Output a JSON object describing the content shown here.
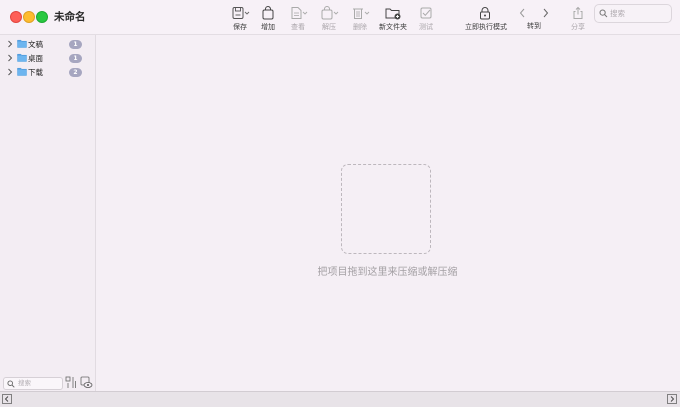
{
  "window": {
    "title": "未命名"
  },
  "toolbar": {
    "save": "保存",
    "add": "增加",
    "view": "查看",
    "extract": "解压",
    "delete": "删除",
    "new_folder": "新文件夹",
    "test": "测试",
    "instant_mode": "立即执行模式",
    "goto": "转到",
    "share": "分享"
  },
  "search": {
    "placeholder": "搜索"
  },
  "sidebar": {
    "items": [
      {
        "name": "文稿",
        "count": "1"
      },
      {
        "name": "桌面",
        "count": "1"
      },
      {
        "name": "下载",
        "count": "2"
      }
    ],
    "search_placeholder": "搜索"
  },
  "main": {
    "drop_hint": "把项目拖到这里来压缩或解压缩"
  },
  "colors": {
    "folder": "#5aa6e6",
    "badge": "#a6a6c0",
    "close": "#fe5f57",
    "minimize": "#febc2e",
    "maximize": "#28c840"
  },
  "icons": {
    "save": "save-icon",
    "add": "bag-icon",
    "view": "document-icon",
    "extract": "bag-open-icon",
    "delete": "trash-icon",
    "new_folder": "folder-plus-icon",
    "test": "checkbox-icon",
    "instant_mode": "lock-icon",
    "back": "chevron-left-icon",
    "forward": "chevron-right-icon",
    "share": "share-icon"
  }
}
